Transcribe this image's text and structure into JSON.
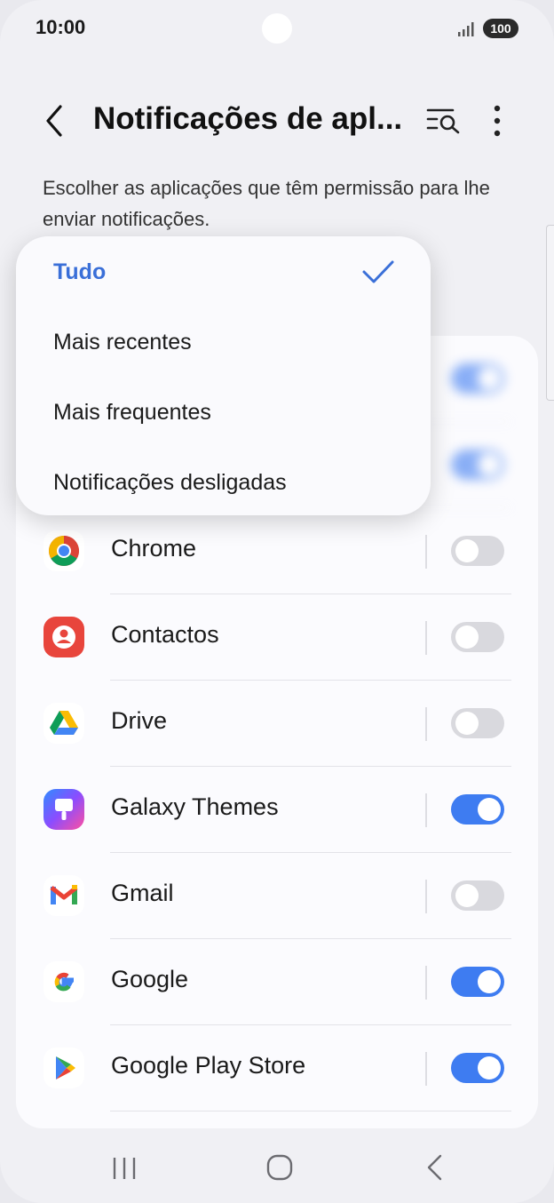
{
  "status_bar": {
    "time": "10:00",
    "battery": "100"
  },
  "header": {
    "title": "Notificações de apl...",
    "description": "Escolher as aplicações que têm permissão para lhe enviar notificações."
  },
  "filter_menu": {
    "options": [
      {
        "label": "Tudo",
        "selected": true
      },
      {
        "label": "Mais recentes",
        "selected": false
      },
      {
        "label": "Mais frequentes",
        "selected": false
      },
      {
        "label": "Notificações desligadas",
        "selected": false
      }
    ]
  },
  "apps": [
    {
      "name": "Chrome",
      "notifications_on": false,
      "icon": "chrome-icon"
    },
    {
      "name": "Contactos",
      "notifications_on": false,
      "icon": "contacts-icon"
    },
    {
      "name": "Drive",
      "notifications_on": false,
      "icon": "drive-icon"
    },
    {
      "name": "Galaxy Themes",
      "notifications_on": true,
      "icon": "galaxy-themes-icon"
    },
    {
      "name": "Gmail",
      "notifications_on": false,
      "icon": "gmail-icon"
    },
    {
      "name": "Google",
      "notifications_on": true,
      "icon": "google-icon"
    },
    {
      "name": "Google Play Store",
      "notifications_on": true,
      "icon": "play-store-icon"
    }
  ],
  "hidden_rows_toggles": [
    true,
    true
  ],
  "colors": {
    "accent": "#3e7cf1",
    "selected_text": "#3a6fd8",
    "toggle_off": "#d9d9de"
  }
}
